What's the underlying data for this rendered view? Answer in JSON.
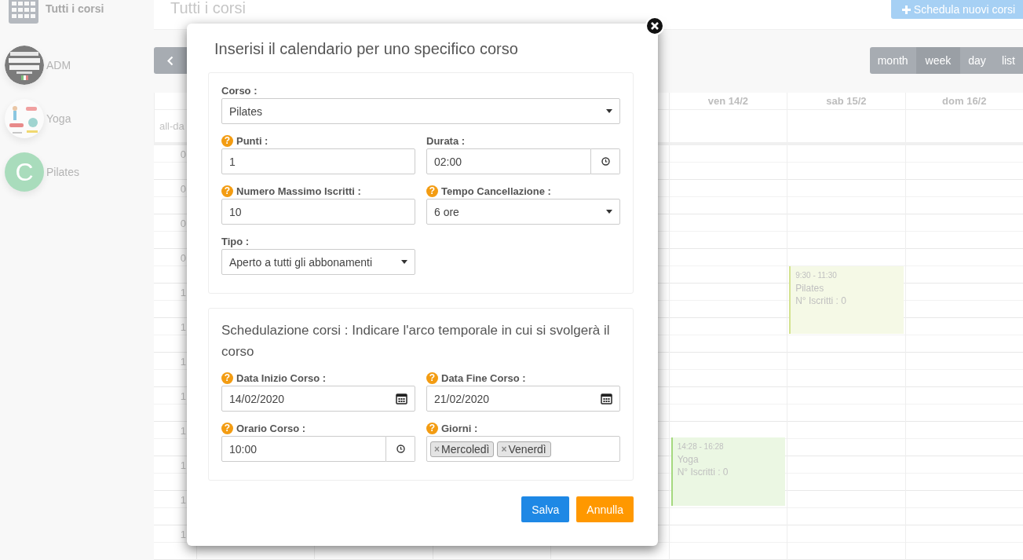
{
  "sidebar": {
    "header": {
      "label": "Tutti i corsi"
    },
    "items": [
      {
        "kind": "picture",
        "label": "ADM"
      },
      {
        "kind": "picture",
        "label": "Yoga"
      },
      {
        "kind": "letter",
        "letter": "C",
        "label": "Pilates"
      }
    ]
  },
  "header": {
    "title": "Tutti i corsi",
    "new_button": "Schedula nuovi corsi"
  },
  "toolbar": {
    "views": [
      {
        "label": "month",
        "selected": false
      },
      {
        "label": "week",
        "selected": true
      },
      {
        "label": "day",
        "selected": false
      },
      {
        "label": "list",
        "selected": false
      }
    ]
  },
  "calendar": {
    "all_day_label": "all-da",
    "days": [
      {
        "label": "ven 14/2",
        "events": [
          {
            "time": "14:28 - 16:28",
            "title": "Yoga",
            "info": "N° Iscritti : 0",
            "color": "#a5d97f"
          }
        ]
      },
      {
        "label": "sab 15/2",
        "events": [
          {
            "time": "9:30 - 11:30",
            "title": "Pilates",
            "info": "N° Iscritti : 0",
            "color": "#d3e38f"
          }
        ]
      },
      {
        "label": "dom 16/2"
      }
    ],
    "hours": [
      "0",
      "0",
      "0",
      "0",
      "1",
      "1",
      "1",
      "1",
      "1",
      "1",
      "1",
      "1"
    ]
  },
  "modal": {
    "title": "Inserisi il calendario per uno specifico corso",
    "sections": [
      {
        "fields": [
          {
            "kind": "select",
            "label": "Corso :",
            "value": "Pilates"
          },
          {
            "kind": "text",
            "label": "Punti :",
            "help": "?",
            "value": "1"
          },
          {
            "kind": "time",
            "label": "Durata :",
            "value": "02:00"
          },
          {
            "kind": "text",
            "label": "Numero Massimo Iscritti :",
            "help": "?",
            "value": "10"
          },
          {
            "kind": "select",
            "label": "Tempo Cancellazione :",
            "help": "?",
            "value": "6 ore"
          },
          {
            "kind": "select",
            "label": "Tipo :",
            "value": "Aperto a tutti gli abbonamenti"
          }
        ]
      },
      {
        "heading": "Schedulazione corsi : Indicare l'arco temporale in cui si svolgerà il corso",
        "fields": [
          {
            "kind": "date",
            "label": "Data Inizio Corso :",
            "help": "?",
            "value": "14/02/2020"
          },
          {
            "kind": "date",
            "label": "Data Fine Corso :",
            "help": "?",
            "value": "21/02/2020"
          },
          {
            "kind": "time",
            "label": "Orario Corso :",
            "help": "?",
            "value": "10:00"
          },
          {
            "kind": "tags",
            "label": "Giorni :",
            "help": "?",
            "tags": [
              {
                "remove": "×",
                "label": "Mercoledì"
              },
              {
                "remove": "×",
                "label": "Venerdì"
              }
            ]
          }
        ]
      }
    ],
    "buttons": [
      {
        "kind": "primary",
        "label": "Salva"
      },
      {
        "kind": "warning",
        "label": "Annulla"
      }
    ]
  }
}
